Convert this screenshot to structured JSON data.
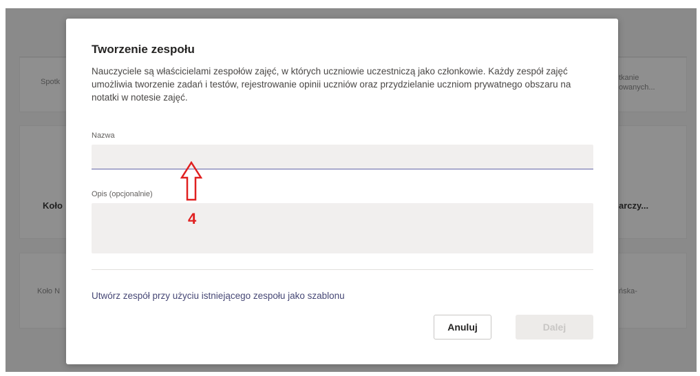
{
  "background": {
    "cards": [
      {
        "left_text": "Spotk",
        "right_text_1": "tkanie",
        "right_text_2": "owanych..."
      },
      {
        "left_bold": "Koło",
        "right_bold": "arczy..."
      },
      {
        "left_text": "Koło N",
        "right_text": "ńska-"
      }
    ]
  },
  "dialog": {
    "title": "Tworzenie zespołu",
    "description": "Nauczyciele są właścicielami zespołów zajęć, w których uczniowie uczestniczą jako członkowie. Każdy zespół zajęć umożliwia tworzenie zadań i testów, rejestrowanie opinii uczniów oraz przydzielanie uczniom prywatnego obszaru na notatki w notesie zajęć.",
    "name_label": "Nazwa",
    "name_value": "",
    "desc_label": "Opis (opcjonalnie)",
    "desc_value": "",
    "template_link": "Utwórz zespół przy użyciu istniejącego zespołu jako szablonu",
    "cancel_label": "Anuluj",
    "next_label": "Dalej"
  },
  "annotation": {
    "number": "4",
    "color": "#e02020"
  },
  "colors": {
    "accent": "#6264a7",
    "link": "#464775"
  }
}
